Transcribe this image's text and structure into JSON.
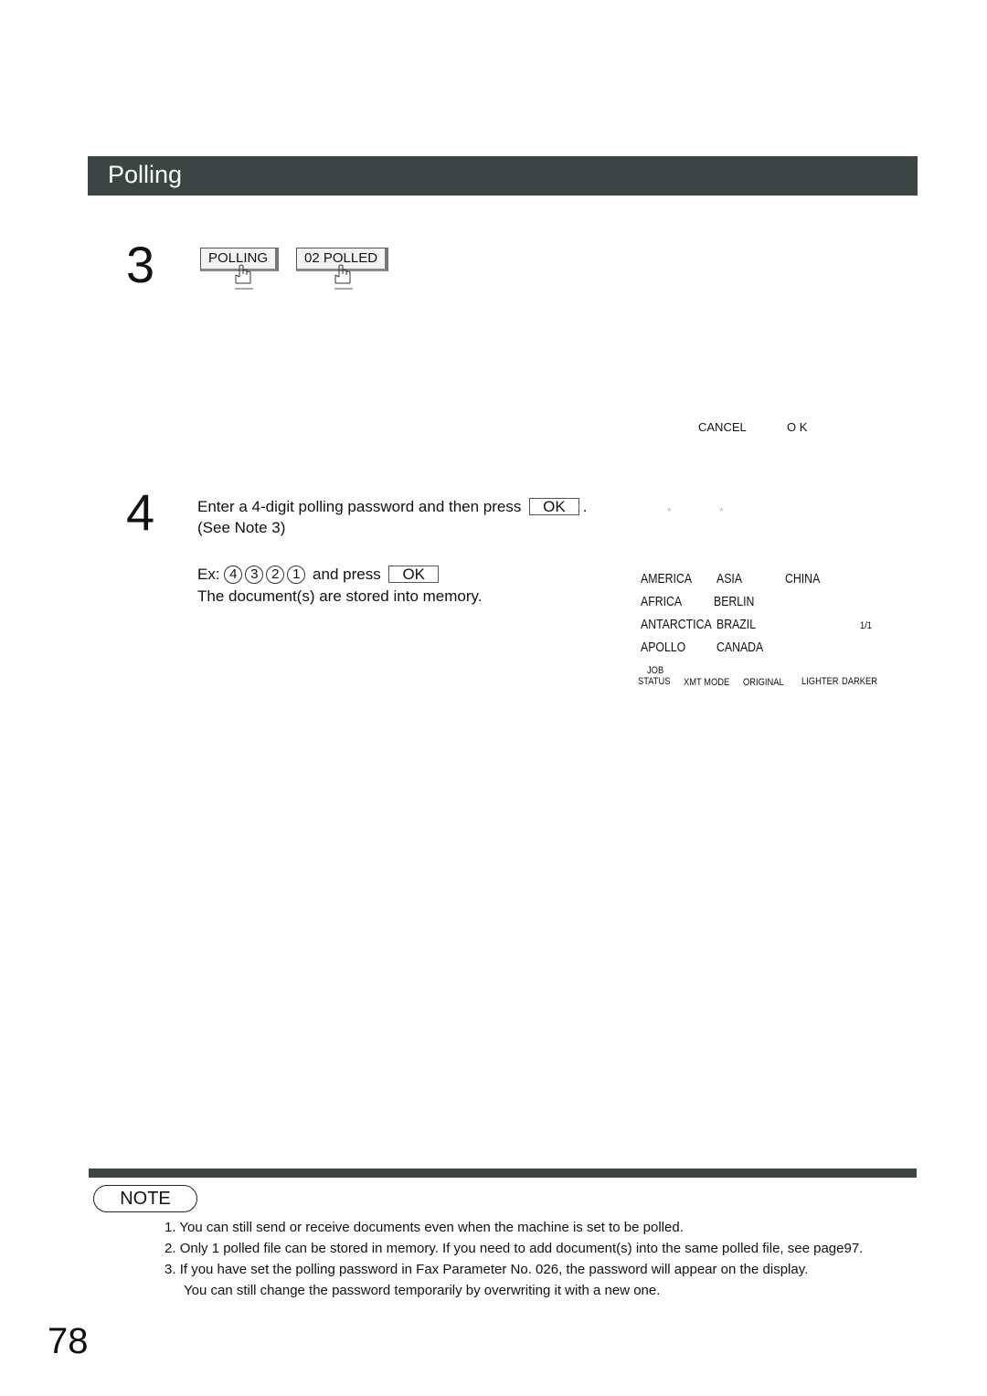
{
  "header": {
    "title": "Polling"
  },
  "step3": {
    "number": "3",
    "keys": [
      {
        "label": "POLLING"
      },
      {
        "label": "02 POLLED"
      }
    ],
    "lcd_softkeys": {
      "cancel": "CANCEL",
      "ok": "O K"
    }
  },
  "step4": {
    "number": "4",
    "instruction_line1_prefix": "Enter a 4-digit polling password and then press",
    "instruction_ok_key": "OK",
    "instruction_line1_suffix": ".",
    "instruction_line2": "(See Note 3)",
    "example_prefix": "Ex:",
    "example_digits": [
      "4",
      "3",
      "2",
      "1"
    ],
    "example_mid": "and press",
    "example_ok_key": "OK",
    "result": "The document(s) are stored into memory.",
    "lcd": {
      "password_mask": [
        "*",
        "*"
      ],
      "directory": [
        [
          "AMERICA",
          "ASIA",
          "CHINA"
        ],
        [
          "AFRICA",
          "BERLIN"
        ],
        [
          "ANTARCTICA",
          "BRAZIL"
        ],
        [
          "APOLLO",
          "CANADA"
        ]
      ],
      "page_indicator": "1/1",
      "softkeys": {
        "job_status_line1": "JOB",
        "job_status_line2": "STATUS",
        "xmt_mode": "XMT MODE",
        "original": "ORIGINAL",
        "lighter": "LIGHTER",
        "darker": "DARKER"
      }
    }
  },
  "note": {
    "label": "NOTE",
    "items": [
      {
        "num": "1.",
        "text": "You can still send or receive documents even when the machine is set to be polled."
      },
      {
        "num": "2.",
        "text": "Only 1 polled file can be stored in memory. If you need to add document(s) into the same polled file, see page97."
      },
      {
        "num": "3.",
        "text": "If you have set the polling password in Fax Parameter No. 026, the password will appear on the display."
      }
    ],
    "item3_continuation": "You can still change the password temporarily by overwriting it with a new one."
  },
  "page_number": "78"
}
